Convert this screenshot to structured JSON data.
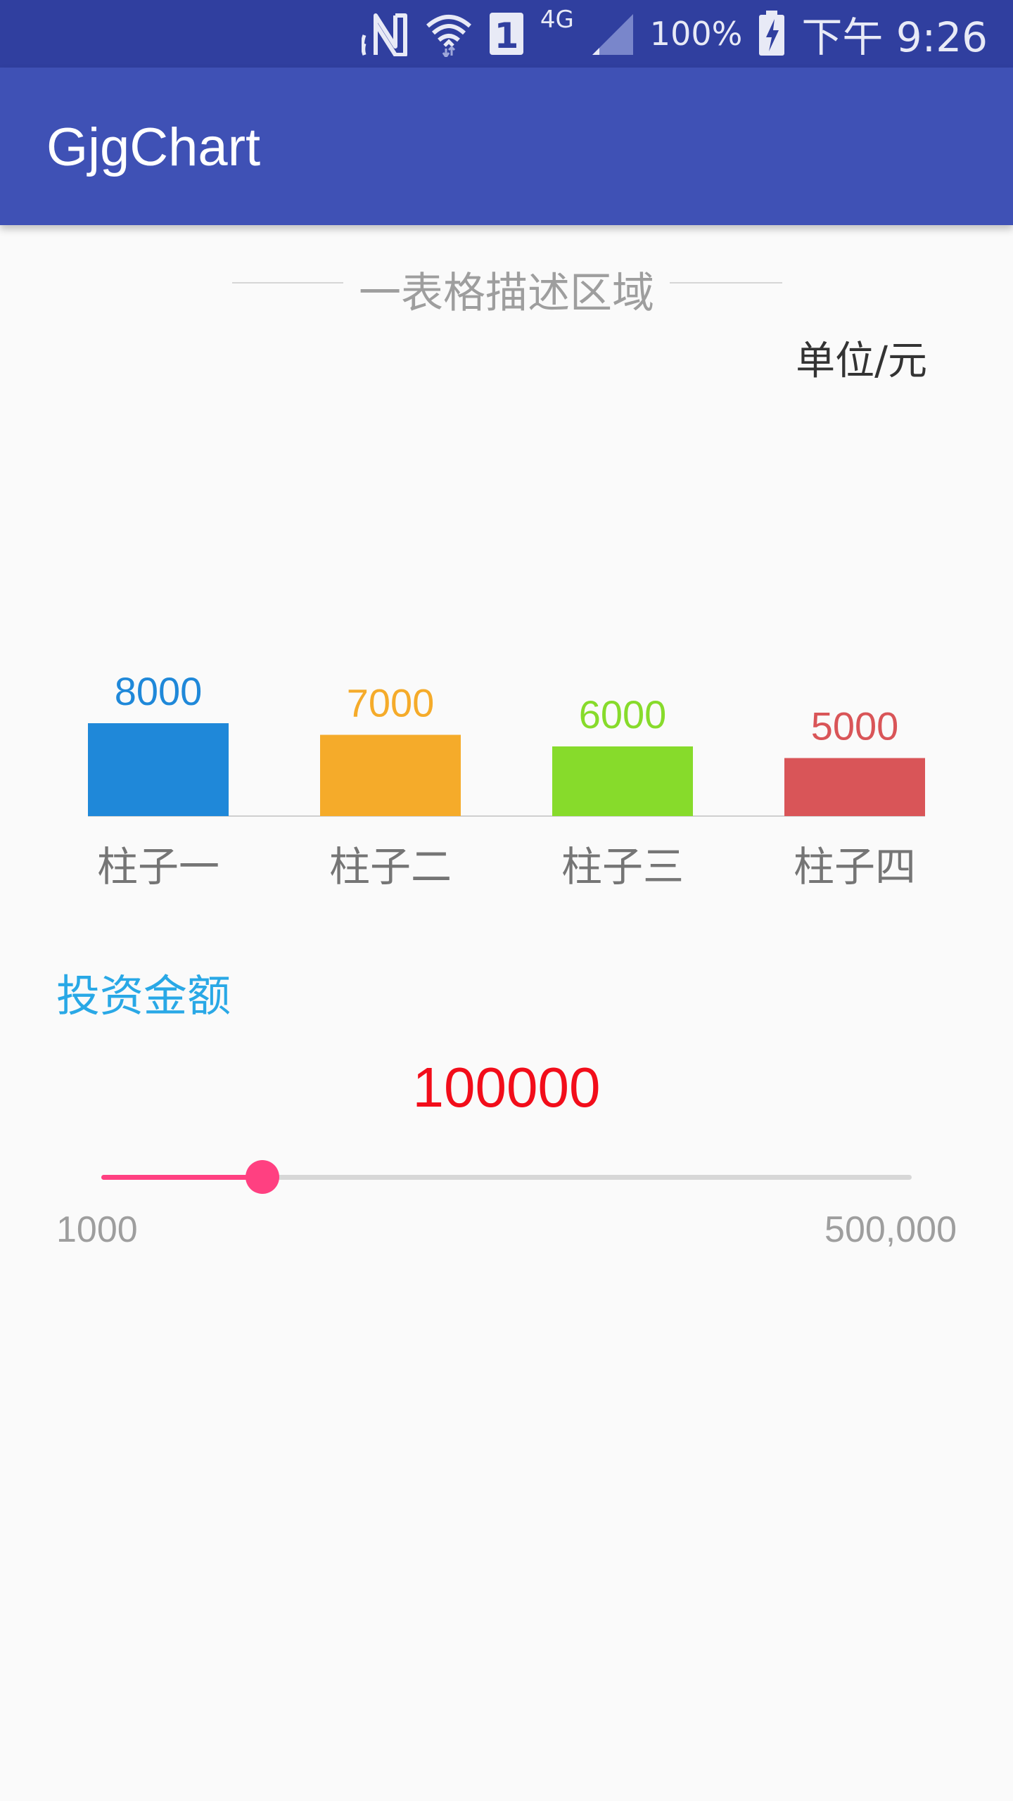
{
  "status_bar": {
    "icons": [
      "nfc-icon",
      "wifi-icon",
      "sim-1-icon",
      "network-4g-icon",
      "signal-icon",
      "battery-charging-icon"
    ],
    "network_type": "4G",
    "sim_slot": "1",
    "battery": "100%",
    "time": "下午 9:26"
  },
  "app_bar": {
    "title": "GjgChart",
    "color": "#3f51b5"
  },
  "chart_section": {
    "description": "一表格描述区域",
    "unit": "单位/元"
  },
  "chart_data": {
    "type": "bar",
    "categories": [
      "柱子一",
      "柱子二",
      "柱子三",
      "柱子四"
    ],
    "values": [
      8000,
      7000,
      6000,
      5000
    ],
    "colors": [
      "#1f88d9",
      "#f5ab2a",
      "#87db2b",
      "#d95558"
    ],
    "ylim": [
      0,
      80000
    ],
    "grid": false,
    "title": "",
    "xlabel": "",
    "ylabel": ""
  },
  "investment": {
    "label": "投资金额",
    "value": "100000",
    "slider_value": 100000,
    "min_label": "1000",
    "max_label": "500,000",
    "min": 1000,
    "max": 500000,
    "accent": "#ff4081"
  }
}
